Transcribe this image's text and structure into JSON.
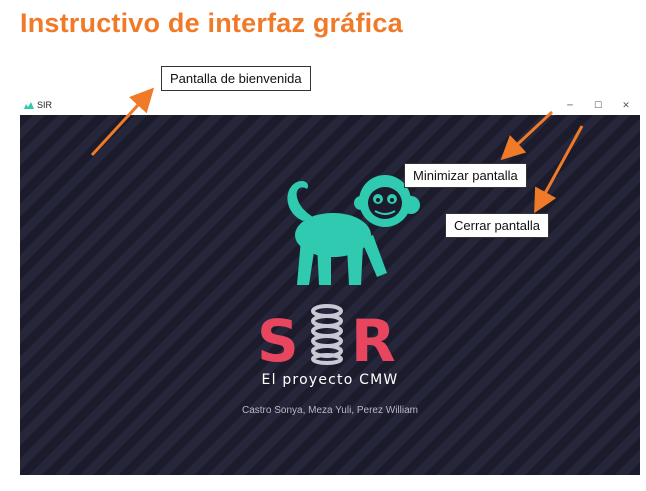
{
  "doc_title": "Instructivo de interfaz gráfica",
  "callouts": {
    "welcome": "Pantalla de bienvenida",
    "minimize": "Minimizar pantalla",
    "close": "Cerrar pantalla"
  },
  "window": {
    "title": "SIR",
    "controls": {
      "minimize": "─",
      "maximize": "☐",
      "close": "✕"
    }
  },
  "splash": {
    "logo_text": "SIR",
    "subtitle": "El proyecto CMW",
    "authors": "Castro Sonya, Meza Yuli, Perez William"
  },
  "colors": {
    "heading": "#f07a28",
    "arrow": "#f07a28",
    "monkey": "#2fcab0",
    "logo_red": "#e8455e",
    "background_dark": "#1b1b2c"
  },
  "icons": {
    "app": "monkey-icon",
    "mascot": "monkey-icon",
    "spring": "spring-icon"
  }
}
